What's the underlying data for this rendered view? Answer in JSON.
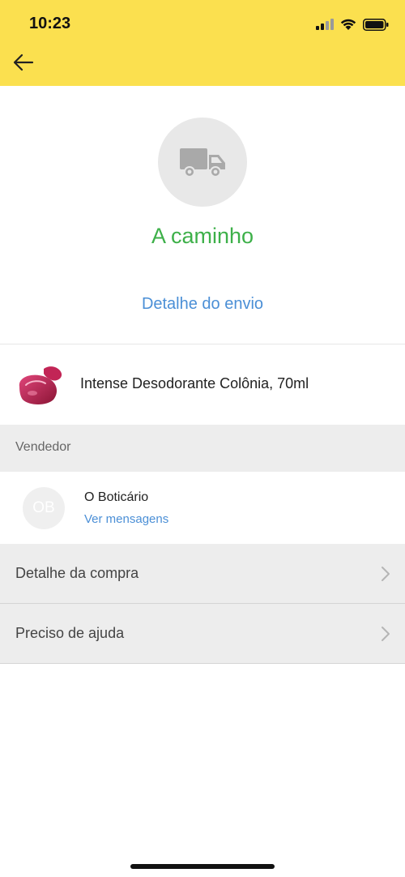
{
  "status_bar": {
    "time": "10:23"
  },
  "header": {
    "back_icon": "arrow-left-icon"
  },
  "shipment": {
    "icon": "truck-icon",
    "status": "A caminho",
    "detail_link": "Detalhe do envio",
    "status_color": "#3db049"
  },
  "product": {
    "name": "Intense Desodorante Colônia, 70ml",
    "thumb_icon": "perfume-bottle-image"
  },
  "seller_section": {
    "header": "Vendedor",
    "avatar_initials": "OB",
    "name": "O Boticário",
    "messages_link": "Ver mensagens"
  },
  "actions": [
    {
      "label": "Detalhe da compra"
    },
    {
      "label": "Preciso de ajuda"
    }
  ],
  "colors": {
    "accent": "#fbe04f",
    "link": "#4b8fd6",
    "success": "#3db049"
  }
}
